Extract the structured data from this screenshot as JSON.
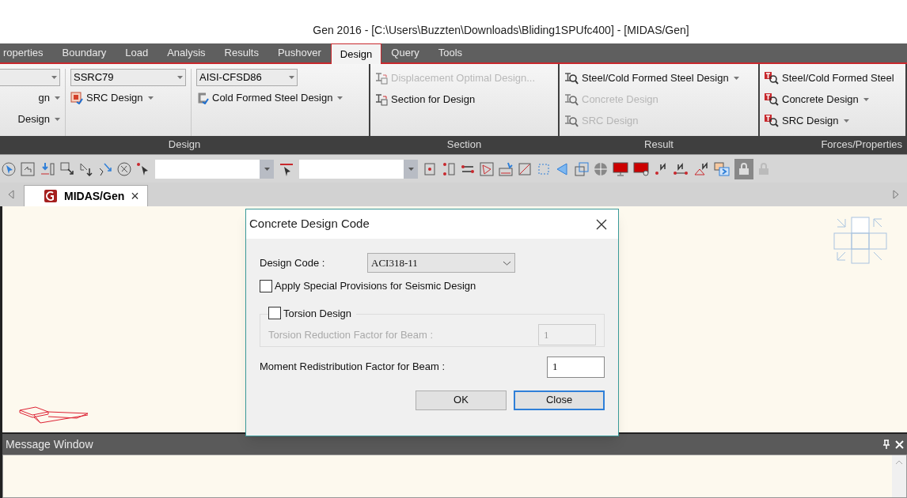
{
  "window": {
    "title": "Gen 2016 - [C:\\Users\\Buzzten\\Downloads\\Bliding1SPUfc400] - [MIDAS/Gen]"
  },
  "menu_tabs": [
    {
      "label": "roperties",
      "selected": false
    },
    {
      "label": "Boundary",
      "selected": false
    },
    {
      "label": "Load",
      "selected": false
    },
    {
      "label": "Analysis",
      "selected": false
    },
    {
      "label": "Results",
      "selected": false
    },
    {
      "label": "Pushover",
      "selected": false
    },
    {
      "label": "Design",
      "selected": true
    },
    {
      "label": "Query",
      "selected": false
    },
    {
      "label": "Tools",
      "selected": false
    }
  ],
  "ribbon": [
    {
      "label": "Design",
      "columns": [
        [
          {
            "kind": "combo"
          },
          {
            "kind": "command",
            "label": "gn",
            "dropdown": true,
            "disabled": false
          },
          {
            "kind": "command",
            "label": "Design",
            "dropdown": true,
            "disabled": false
          }
        ],
        [
          {
            "kind": "combo",
            "value": "SSRC79"
          },
          {
            "kind": "command",
            "label": "SRC Design",
            "dropdown": true,
            "disabled": false
          }
        ],
        [
          {
            "kind": "combo",
            "value": "AISI-CFSD86"
          },
          {
            "kind": "command",
            "label": "Cold Formed Steel Design",
            "dropdown": true,
            "disabled": false
          }
        ]
      ]
    },
    {
      "label": "Section",
      "columns": [
        [
          {
            "kind": "command",
            "label": "Displacement Optimal Design...",
            "dropdown": false,
            "disabled": true
          },
          {
            "kind": "command",
            "label": "Section for Design",
            "dropdown": false,
            "disabled": false
          }
        ]
      ]
    },
    {
      "label": "Result",
      "columns": [
        [
          {
            "kind": "command",
            "label": "Steel/Cold Formed Steel Design",
            "dropdown": true,
            "disabled": false
          },
          {
            "kind": "command",
            "label": "Concrete Design",
            "dropdown": false,
            "disabled": true
          },
          {
            "kind": "command",
            "label": "SRC Design",
            "dropdown": false,
            "disabled": true
          }
        ]
      ]
    },
    {
      "label": "Forces/Properties",
      "columns": [
        [
          {
            "kind": "command",
            "label": "Steel/Cold Formed Steel",
            "dropdown": false,
            "disabled": false
          },
          {
            "kind": "command",
            "label": "Concrete Design",
            "dropdown": true,
            "disabled": false
          },
          {
            "kind": "command",
            "label": "SRC Design",
            "dropdown": true,
            "disabled": false
          }
        ]
      ]
    }
  ],
  "document_tab": {
    "label": "MIDAS/Gen",
    "close": "×"
  },
  "dialog": {
    "title": "Concrete Design Code",
    "design_code_label": "Design Code :",
    "design_code": "ACI318-11",
    "seismic": {
      "label": "Apply Special Provisions for Seismic Design",
      "checked": false
    },
    "torsion": {
      "label": "Torsion Design",
      "checked": false
    },
    "torsion_factor": {
      "label": "Torsion Reduction Factor for Beam :",
      "value": "1",
      "disabled": true
    },
    "moment_factor": {
      "label": "Moment Redistribution Factor for Beam :",
      "value": "1"
    },
    "buttons": [
      {
        "label": "OK",
        "selected": false
      },
      {
        "label": "Close",
        "selected": true
      }
    ]
  },
  "message_window": {
    "title": "Message Window"
  }
}
